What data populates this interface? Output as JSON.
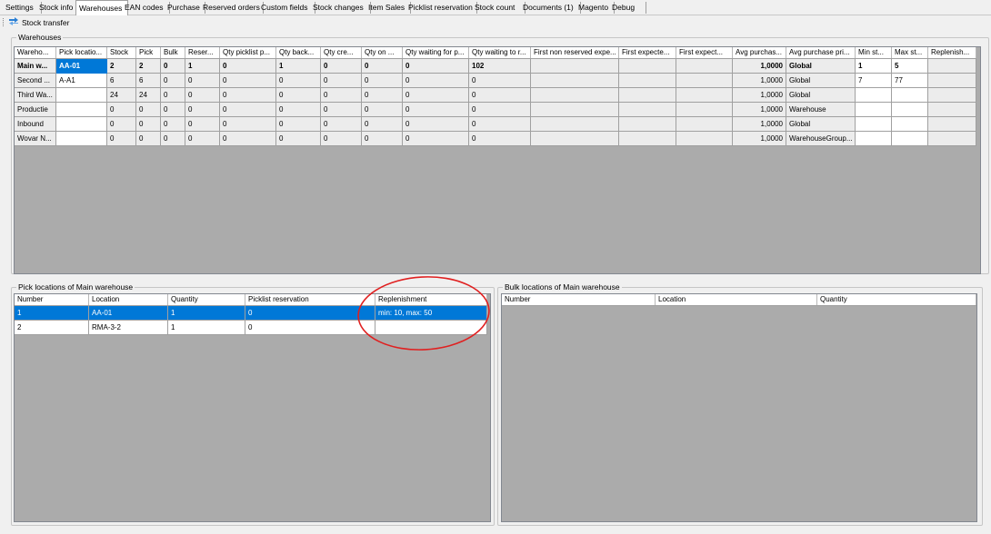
{
  "tabs": [
    "Settings",
    "Stock info",
    "Warehouses",
    "EAN codes",
    "Purchase",
    "Reserved orders",
    "Custom fields",
    "Stock changes",
    "Item Sales",
    "Picklist reservation",
    "Stock count",
    "Documents (1)",
    "Magento",
    "Debug"
  ],
  "active_tab": "Warehouses",
  "toolbar": {
    "stock_transfer_label": "Stock transfer",
    "stock_transfer_icon": "stock-transfer-icon"
  },
  "warehouses": {
    "title": "Warehouses",
    "columns": [
      "Wareho...",
      "Pick locatio...",
      "Stock",
      "Pick",
      "Bulk",
      "Reser...",
      "Qty picklist p...",
      "Qty back...",
      "Qty cre...",
      "Qty on ...",
      "Qty waiting for p...",
      "Qty waiting to r...",
      "First non reserved expe...",
      "First expecte...",
      "First expect...",
      "Avg purchas...",
      "Avg purchase pri...",
      "Min st...",
      "Max st...",
      "Replenish..."
    ],
    "rows": [
      [
        "Main w...",
        "AA-01",
        "2",
        "2",
        "0",
        "1",
        "0",
        "1",
        "0",
        "0",
        "0",
        "102",
        "",
        "",
        "",
        "1,0000",
        "Global",
        "1",
        "5",
        ""
      ],
      [
        "Second ...",
        "A-A1",
        "6",
        "6",
        "0",
        "0",
        "0",
        "0",
        "0",
        "0",
        "0",
        "0",
        "",
        "",
        "",
        "1,0000",
        "Global",
        "7",
        "77",
        ""
      ],
      [
        "Third Wa...",
        "",
        "24",
        "24",
        "0",
        "0",
        "0",
        "0",
        "0",
        "0",
        "0",
        "0",
        "",
        "",
        "",
        "1,0000",
        "Global",
        "",
        "",
        ""
      ],
      [
        "Productie",
        "",
        "0",
        "0",
        "0",
        "0",
        "0",
        "0",
        "0",
        "0",
        "0",
        "0",
        "",
        "",
        "",
        "1,0000",
        "Warehouse",
        "",
        "",
        ""
      ],
      [
        "Inbound",
        "",
        "0",
        "0",
        "0",
        "0",
        "0",
        "0",
        "0",
        "0",
        "0",
        "0",
        "",
        "",
        "",
        "1,0000",
        "Global",
        "",
        "",
        ""
      ],
      [
        "Wovar N...",
        "",
        "0",
        "0",
        "0",
        "0",
        "0",
        "0",
        "0",
        "0",
        "0",
        "0",
        "",
        "",
        "",
        "1,0000",
        "WarehouseGroup...",
        "",
        "",
        ""
      ]
    ]
  },
  "pick_locations": {
    "title": "Pick locations of Main warehouse",
    "columns": [
      "Number",
      "Location",
      "Quantity",
      "Picklist reservation",
      "Replenishment"
    ],
    "rows": [
      [
        "1",
        "AA-01",
        "1",
        "0",
        "min: 10, max: 50"
      ],
      [
        "2",
        "RMA-3-2",
        "1",
        "0",
        ""
      ]
    ]
  },
  "bulk_locations": {
    "title": "Bulk locations of Main warehouse",
    "columns": [
      "Number",
      "Location",
      "Quantity"
    ]
  },
  "colors": {
    "selection": "#0078d7",
    "annotation": "#e02020",
    "grid_empty": "#ababab"
  }
}
